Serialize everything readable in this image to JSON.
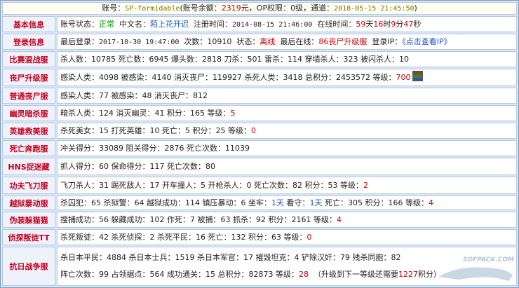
{
  "header": {
    "account_label": "账号：",
    "account": "SP-formidable",
    "balance_label": "(账号余额：",
    "balance": "2319",
    "balance_unit": "元，OP权限：",
    "op_level": "0级",
    "channel_label": "，通道：",
    "datetime": "2018-05-15 21:45:50",
    "close": ")"
  },
  "rows": {
    "basic": {
      "label": "基本信息",
      "status_label": "账号状态：",
      "status": "正常",
      "cn_name_label": "中文名：",
      "cn_name": "陌上花开迟",
      "reg_label": "注册时间：",
      "reg_time": "2014-08-15 21:46:00",
      "online_label": "在线时间：",
      "online_days": "59",
      "online_days_unit": "天",
      "online_hours": "16",
      "online_hours_unit": "时",
      "online_min": "9",
      "online_min_unit": "分",
      "online_sec": "47",
      "online_sec_unit": "秒"
    },
    "login": {
      "label": "登录信息",
      "last_login_label": "最后登录：",
      "last_login": "2017-10-30 19:47:00",
      "times_label": "次数：",
      "times": "10910",
      "state_label": "状态：",
      "state": "离线",
      "last_online_label": "最后在线：",
      "last_online": "86丧尸升级服",
      "ip_label": "登录IP：",
      "ip_link": "《点击查看IP》"
    },
    "mixed": {
      "label": "比赛混战服",
      "text": "杀人数：10785  死亡数：6945  爆头数：2818  刀杀：501  雷杀：114  穿墙杀人：323  被闪杀人：10"
    },
    "zombie_up": {
      "label": "丧尸升级服",
      "text_pre": "感染人类：4098  被感染：4140  消灭丧尸：119927  杀死人类：3418  总积分：2453572  等级：",
      "level": "700"
    },
    "zombie_normal": {
      "label": "普通丧尸服",
      "text": "感染人类：77  被感染：48  消灭丧尸：812"
    },
    "ghost": {
      "label": "幽灵暗杀服",
      "text_pre": "暗杀人类：124  消灭幽灵：41  积分：165  等级：",
      "level": "5"
    },
    "hero": {
      "label": "英雄救美服",
      "text_pre": "杀死美女：15  打死英雄：10  死亡：5  积分：25  等级：",
      "level": "0"
    },
    "deathrun": {
      "label": "死亡奔跑服",
      "text": "冲关得分：33089  阻关得分：2876  死亡次数：11039"
    },
    "hns": {
      "label": "HNS捉迷藏",
      "text": "抓人得分：60  保命得分：117  死亡次数：80"
    },
    "kungfu": {
      "label": "功夫飞刀服",
      "text_pre": "飞刀杀人：31  踢死敌人：17  开车撞人：5  开枪杀人：0  死亡次数：82  积分：53  等级：",
      "level": "2"
    },
    "jailbreak": {
      "label": "越狱暴动服",
      "text_pre": "杀囚犯：65  杀狱警：64  越狱成功：114  镇压暴动：6  坐牢：",
      "jail": "1天",
      "mid": "  看守：",
      "guard": "1天",
      "text_post": "  死亡：305  积分：166  等级：",
      "level": "4"
    },
    "catmouse": {
      "label": "伪装躲猫猫",
      "text_pre": "搜捕成功：56  躲藏成功：102  作死：7  被捕：63  抓杀：92  积分：2161  等级：",
      "level": "4"
    },
    "detective": {
      "label": "侦探叛徒TT",
      "text_pre": "杀死叛徒：42  杀死侦探：2  杀死平民：16  死亡：132  积分：63  等级：",
      "level": "0"
    },
    "antiwar": {
      "label": "抗日战争服",
      "line1": "杀日本平民：4884  杀日本士兵：1519  杀日本军官：17  摧毁坦克：4  铲除汉奸：79  残杀同胞：82",
      "line2_pre": "阵亡次数：99  占领据点：564  成功通关：15  总积分：82873  等级：",
      "level": "28",
      "line2_mid": "（升级到下一等级还需要",
      "need": "1227",
      "line2_post": "积分）"
    }
  },
  "watermark": "SOFPACK.COM",
  "colors": {
    "label_red": "#c8001e",
    "status_green": "#00a000",
    "link_blue": "#1a56c8",
    "value_red": "#cc0000"
  }
}
